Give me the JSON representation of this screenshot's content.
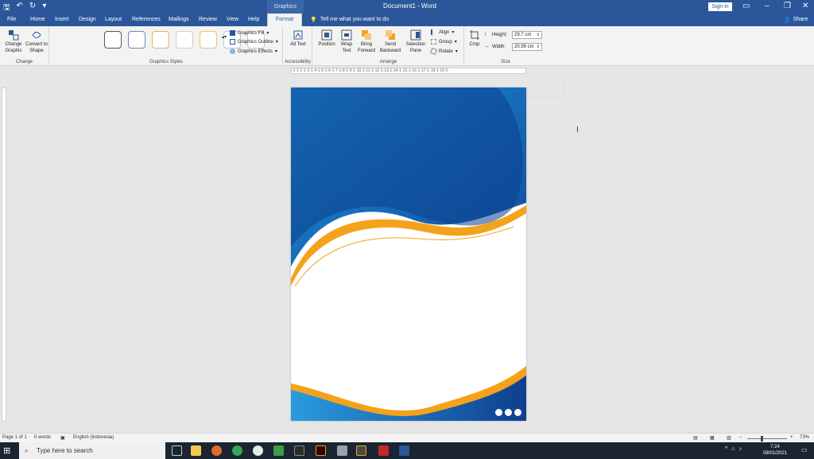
{
  "titlebar": {
    "context_tab": "Graphics Tools",
    "document_title": "Document1  -  Word",
    "sign_in": "Sign in",
    "quick_access": [
      "save-icon",
      "undo-icon",
      "redo-icon",
      "customize-icon"
    ]
  },
  "menubar": {
    "tabs": [
      "File",
      "Home",
      "Insert",
      "Design",
      "Layout",
      "References",
      "Mailings",
      "Review",
      "View",
      "Help",
      "Format"
    ],
    "active_tab": "Format",
    "tell_me": "Tell me what you want to do",
    "share": "Share"
  },
  "ribbon": {
    "change_group": {
      "label": "Change",
      "change_graphic": "Change Graphic",
      "convert": "Convert to Shape"
    },
    "graphics_styles": {
      "label": "Graphics Styles",
      "fill": "Graphics Fill",
      "outline": "Graphics Outline",
      "effects": "Graphics Effects",
      "swatch_borders": [
        "#555555",
        "#6f87b3",
        "#e0b45a",
        "#cfcfcf",
        "#e8c85a",
        "#b5c7de",
        "#c9c9c9"
      ]
    },
    "accessibility": {
      "label": "Accessibility",
      "alt_text": "Alt Text"
    },
    "arrange": {
      "label": "Arrange",
      "position": "Position",
      "wrap_text": "Wrap Text",
      "bring_forward": "Bring Forward",
      "send_backward": "Send Backward",
      "selection_pane": "Selection Pane",
      "align": "Align",
      "group": "Group",
      "rotate": "Rotate"
    },
    "size": {
      "label": "Size",
      "crop": "Crop",
      "height_label": "Height:",
      "height_value": "29.7 cm",
      "width_label": "Width:",
      "width_value": "20.99 cm"
    }
  },
  "ruler": {
    "marks": "·1·1·2·1·3·1·4·1·5·1·6·1·7·1·8·1·9·1·10·1·11·1·12·1·13·1·14·1·15·1·16·1·17·1·18·1·19·1·"
  },
  "statusbar": {
    "page": "Page 1 of 1",
    "words": "0 words",
    "language": "English (Indonesia)",
    "zoom": "73%"
  },
  "taskbar": {
    "search_placeholder": "Type here to search",
    "time": "7:24",
    "date": "08/01/2021"
  },
  "colors": {
    "word_blue": "#2b579a",
    "design_blue": "#1a6fc0",
    "design_orange": "#f4a21a"
  }
}
